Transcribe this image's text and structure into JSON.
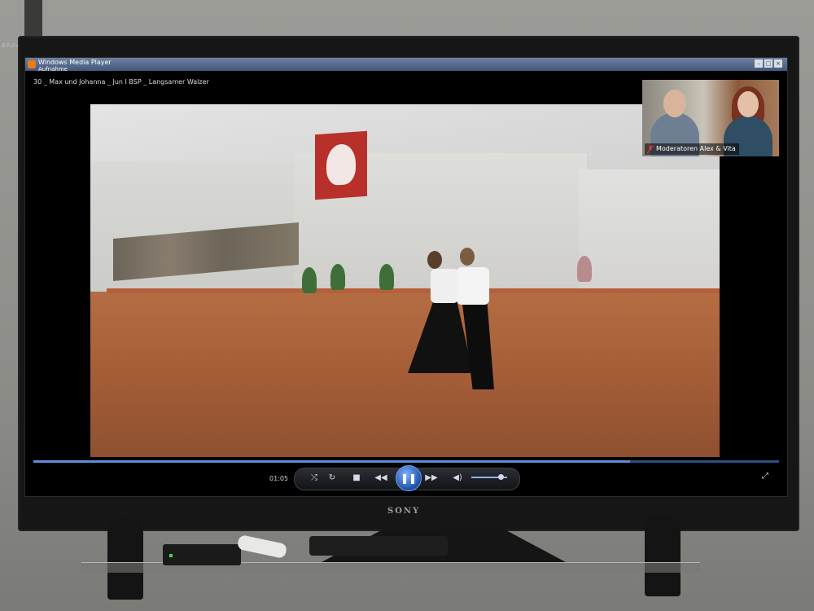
{
  "room": {
    "tv_brand_top": "BRAVIA",
    "tv_brand_bottom": "SONY"
  },
  "player": {
    "window_title": "Windows Media Player",
    "subtitle": "Aufnahme",
    "file_label": "30 _ Max und Johanna _ Jun I BSP _ Langsamer Walzer",
    "time": "01:05",
    "progress": 0.8,
    "volume": 0.85,
    "controls": {
      "shuffle_icon": "shuffle-icon",
      "repeat_icon": "repeat-icon",
      "stop_icon": "stop-icon",
      "prev_icon": "previous-icon",
      "play_pause_icon": "pause-icon",
      "next_icon": "next-icon",
      "volume_icon": "volume-icon",
      "fullscreen_icon": "fullscreen-icon"
    },
    "window_buttons": [
      "–",
      "□",
      "×"
    ]
  },
  "webcam": {
    "label": "Moderatoren Alex & Vita",
    "mic_icon": "mic-muted-icon"
  }
}
